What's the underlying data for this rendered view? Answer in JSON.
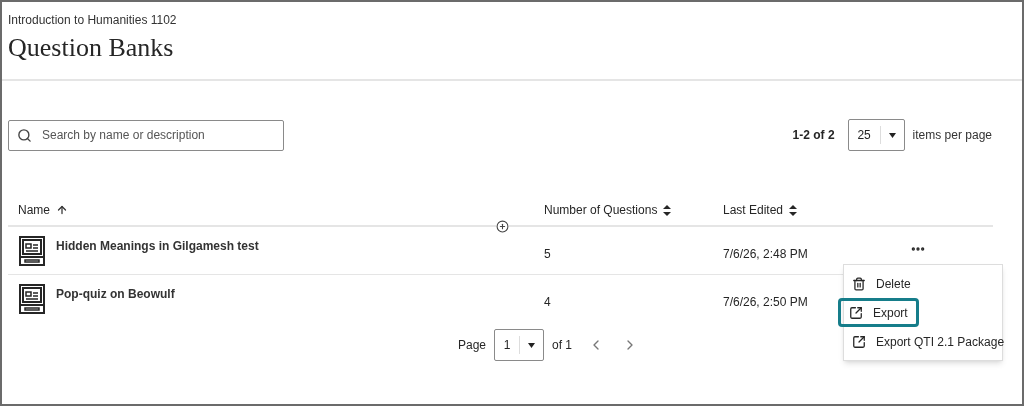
{
  "breadcrumb": "Introduction to Humanities 1102",
  "title": "Question Banks",
  "search": {
    "placeholder": "Search by name or description"
  },
  "paging": {
    "range": "1-2 of 2",
    "per_page": "25",
    "per_page_label": "items per page"
  },
  "table": {
    "columns": [
      {
        "label": "Name",
        "sorted": true
      },
      {
        "label": "Number of Questions",
        "sorted": false
      },
      {
        "label": "Last Edited",
        "sorted": false
      }
    ],
    "rows": [
      {
        "name": "Hidden Meanings in Gilgamesh test",
        "questions": "5",
        "edited": "7/6/26, 2:48 PM"
      },
      {
        "name": "Pop-quiz on Beowulf",
        "questions": "4",
        "edited": "7/6/26, 2:50 PM"
      }
    ]
  },
  "row_menu": {
    "items": [
      {
        "kind": "delete",
        "label": "Delete",
        "selected": false
      },
      {
        "kind": "export",
        "label": "Export",
        "selected": true
      },
      {
        "kind": "export",
        "label": "Export QTI 2.1 Package",
        "selected": false
      }
    ]
  },
  "pager": {
    "label": "Page",
    "page": "1",
    "of": "of 1"
  }
}
